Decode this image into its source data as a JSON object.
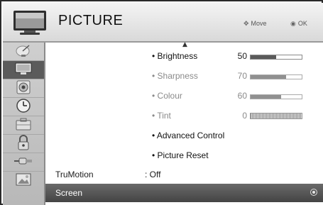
{
  "header": {
    "title": "PICTURE",
    "hint_move": "Move",
    "hint_ok": "OK"
  },
  "sidebar": {
    "items": [
      {
        "icon": "satellite-dish-icon",
        "active": false
      },
      {
        "icon": "tv-screen-icon",
        "active": true
      },
      {
        "icon": "speaker-icon",
        "active": false
      },
      {
        "icon": "clock-icon",
        "active": false
      },
      {
        "icon": "briefcase-icon",
        "active": false
      },
      {
        "icon": "padlock-icon",
        "active": false
      },
      {
        "icon": "cable-plug-icon",
        "active": false
      },
      {
        "icon": "photo-frame-icon",
        "active": false
      }
    ]
  },
  "menu": {
    "brightness": {
      "label": "• Brightness",
      "value": "50",
      "level": 0.5
    },
    "sharpness": {
      "label": "• Sharpness",
      "value": "70",
      "level": 0.7
    },
    "colour": {
      "label": "• Colour",
      "value": "60",
      "level": 0.6
    },
    "tint": {
      "label": "• Tint",
      "value": "0"
    },
    "advanced_control": "• Advanced Control",
    "picture_reset": "• Picture Reset",
    "truemotion": {
      "label": "TruMotion",
      "value": ": Off"
    },
    "screen": {
      "label": "Screen"
    }
  },
  "colors": {
    "selected_row": "#5b5b5b",
    "dim_text": "#8a8a8a"
  }
}
